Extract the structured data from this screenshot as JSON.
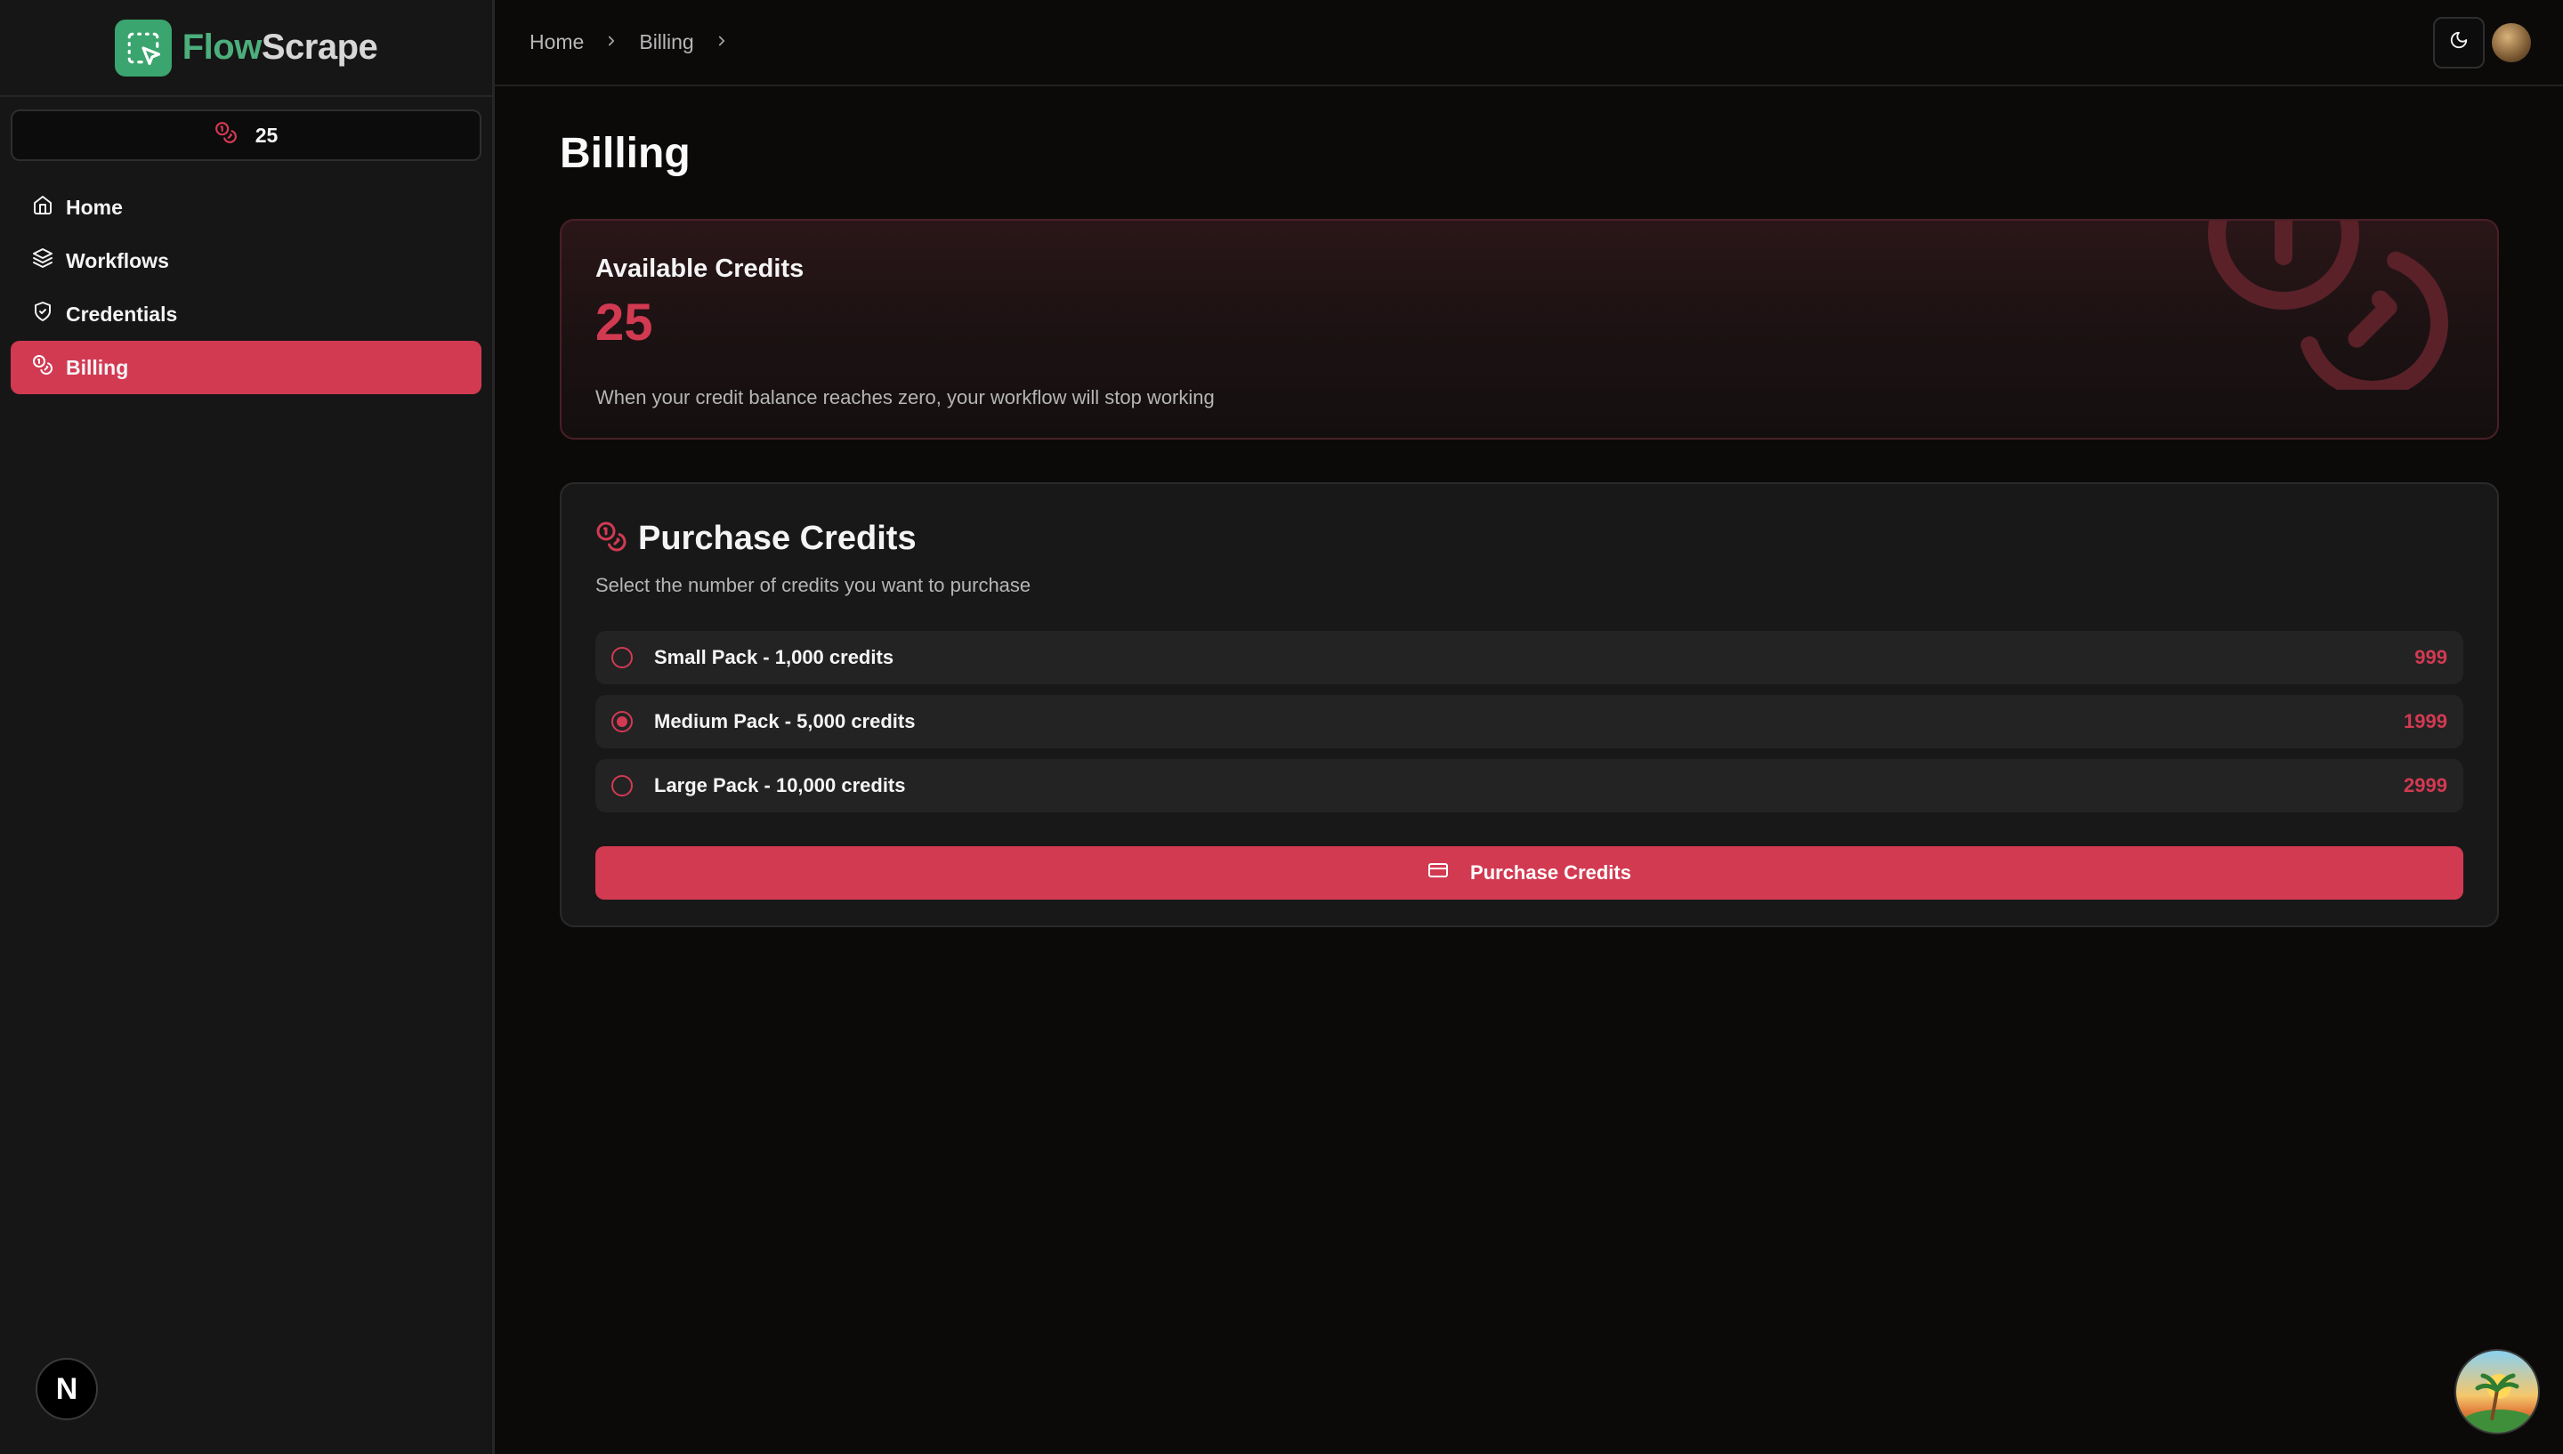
{
  "app": {
    "logo_part1": "Flow",
    "logo_part2": "Scrape",
    "accent_color": "#d23a52",
    "brand_color": "#3aa56e"
  },
  "sidebar": {
    "credits": "25",
    "items": [
      {
        "label": "Home",
        "icon": "home-icon"
      },
      {
        "label": "Workflows",
        "icon": "layers-icon"
      },
      {
        "label": "Credentials",
        "icon": "shield-check-icon"
      },
      {
        "label": "Billing",
        "icon": "coins-icon",
        "active": true
      }
    ],
    "next_badge": "N"
  },
  "breadcrumb": {
    "items": [
      "Home",
      "Billing"
    ]
  },
  "page": {
    "title": "Billing"
  },
  "available": {
    "label": "Available Credits",
    "amount": "25",
    "description": "When your credit balance reaches zero, your workflow will stop working"
  },
  "purchase": {
    "title": "Purchase Credits",
    "subtitle": "Select the number of credits you want to purchase",
    "packs": [
      {
        "label": "Small Pack - 1,000 credits",
        "price": "999",
        "selected": false
      },
      {
        "label": "Medium Pack - 5,000 credits",
        "price": "1999",
        "selected": true
      },
      {
        "label": "Large Pack - 10,000 credits",
        "price": "2999",
        "selected": false
      }
    ],
    "button_label": "Purchase Credits"
  }
}
